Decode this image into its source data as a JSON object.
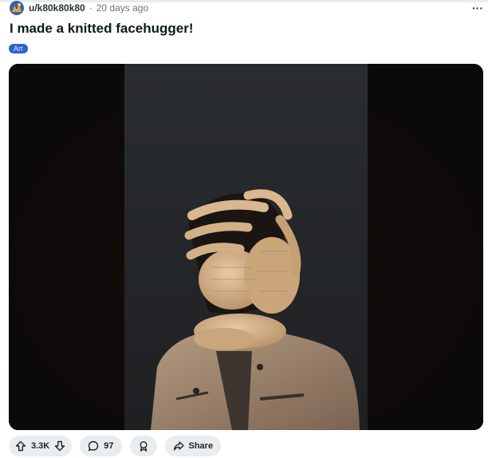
{
  "post": {
    "username": "u/k80k80k80",
    "separator": "·",
    "age": "20 days ago",
    "more_label": "···",
    "title": "I made a knitted facehugger!",
    "flair": "Art"
  },
  "actions": {
    "upvotes": "3.3K",
    "comments": "97",
    "share_label": "Share"
  },
  "icons": {
    "more": "more-options-icon",
    "upvote": "upvote-arrow-icon",
    "downvote": "downvote-arrow-icon",
    "comment": "comment-bubble-icon",
    "award": "award-icon",
    "share": "share-arrow-icon"
  },
  "colors": {
    "flair_bg": "#2a62d2",
    "pill_bg": "#eaedef",
    "text": "#0f1a1c"
  }
}
